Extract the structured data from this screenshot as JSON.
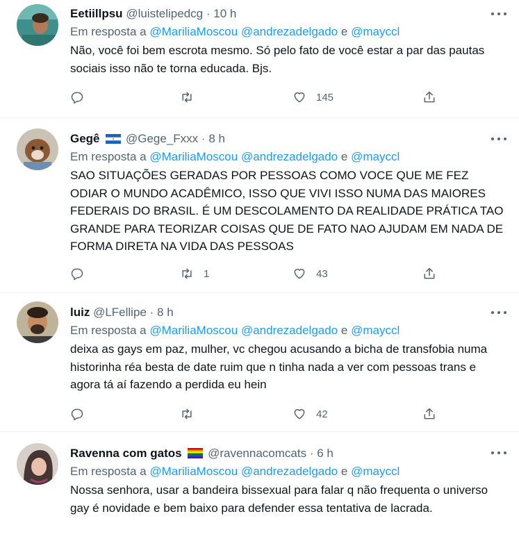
{
  "tweets": [
    {
      "name": "Eetiillpsu",
      "handle": "@luistelipedcg",
      "dot": "·",
      "time": "10 h",
      "reply_prefix": "Em resposta a",
      "reply_user1": "@MariliaMoscou",
      "reply_user2": "@andrezadelgado",
      "reply_and": "e",
      "reply_user3": "@mayccl",
      "text": "Não, você foi bem escrota mesmo. Só pelo fato de você estar a par das pautas sociais isso não te torna educada. Bjs.",
      "retweets": "",
      "likes": "145"
    },
    {
      "name": "Gegê",
      "flag": "honduras-flag",
      "handle": "@Gege_Fxxx",
      "dot": "·",
      "time": "8 h",
      "reply_prefix": "Em resposta a",
      "reply_user1": "@MariliaMoscou",
      "reply_user2": "@andrezadelgado",
      "reply_and": "e",
      "reply_user3": "@mayccl",
      "text": "SAO SITUAÇÕES GERADAS POR PESSOAS COMO VOCE QUE ME FEZ ODIAR O MUNDO ACADÊMICO, ISSO QUE VIVI ISSO NUMA DAS MAIORES FEDERAIS DO BRASIL. É UM DESCOLAMENTO DA REALIDADE PRÁTICA TAO GRANDE PARA TEORIZAR COISAS QUE DE FATO NAO AJUDAM EM NADA DE FORMA DIRETA NA VIDA DAS PESSOAS",
      "retweets": "1",
      "likes": "43"
    },
    {
      "name": "luiz",
      "handle": "@LFellipe",
      "dot": "·",
      "time": "8 h",
      "reply_prefix": "Em resposta a",
      "reply_user1": "@MariliaMoscou",
      "reply_user2": "@andrezadelgado",
      "reply_and": "e",
      "reply_user3": "@mayccl",
      "text": "deixa as gays em paz, mulher, vc chegou acusando a bicha de transfobia numa historinha réa besta de date ruim que n tinha nada a ver com pessoas trans e agora tá aí fazendo a perdida eu hein",
      "retweets": "",
      "likes": "42"
    },
    {
      "name": "Ravenna com gatos",
      "flag": "rainbow-flag",
      "handle": "@ravennacomcats",
      "dot": "·",
      "time": "6 h",
      "reply_prefix": "Em resposta a",
      "reply_user1": "@MariliaMoscou",
      "reply_user2": "@andrezadelgado",
      "reply_and": "e",
      "reply_user3": "@mayccl",
      "text": "Nossa senhora, usar a bandeira bissexual para falar q não frequenta o universo gay é novidade e bem baixo para defender essa tentativa de lacrada.",
      "retweets": "",
      "likes": ""
    }
  ],
  "colors": {
    "text": "#0f1419",
    "secondary": "#536471",
    "link": "#1d9bf0",
    "divider": "#eff3f4"
  }
}
